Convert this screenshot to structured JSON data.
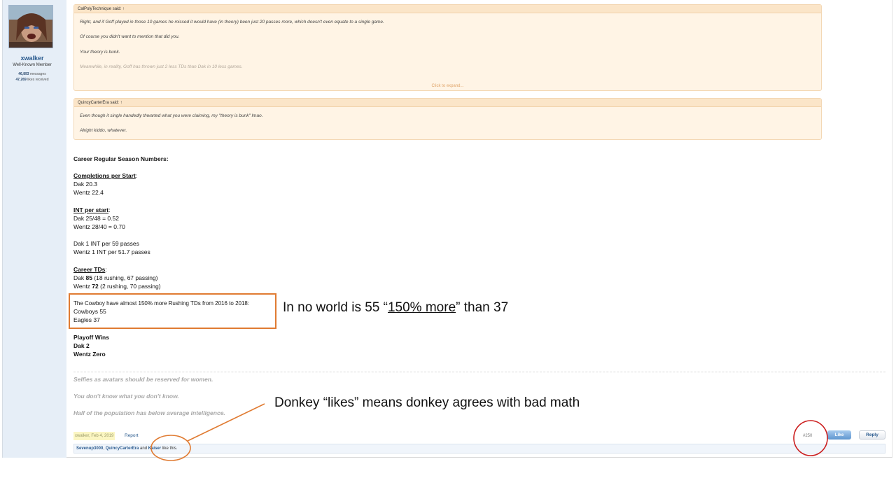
{
  "user": {
    "username": "xwalker",
    "title": "Well-Known Member",
    "messages_count": "46,893",
    "messages_label": "messages",
    "likes_count": "47,269",
    "likes_label": "likes received"
  },
  "quotes": [
    {
      "header": "CalPolyTechnique said: ↑",
      "lines": [
        "Right, and if Goff played in those 10 games he missed it would have (in theory) been just 20 passes more, which doesn't even equate to a single game.",
        "Of course you didn't want to mention that did you.",
        "Your theory is bunk.",
        "Meanwhile, in reality, Goff has thrown just 2 less TDs than Dak in 10 less games."
      ],
      "expand": "Click to expand..."
    },
    {
      "header": "QuincyCarterEra said: ↑",
      "lines": [
        "Even though it single handedly thwarted what you were claiming, my \"theory is bunk\" lmao.",
        "Alright kiddo, whatever."
      ]
    }
  ],
  "post": {
    "heading": "Career Regular Season Numbers:",
    "completions_title": "Completions per Start",
    "completions": [
      "Dak 20.3",
      "Wentz 22.4"
    ],
    "int_title": "INT per start",
    "int_lines": [
      "Dak 25/48 = 0.52",
      "Wentz 28/40 = 0.70"
    ],
    "int_pass_lines": [
      "Dak 1 INT per 59 passes",
      "Wentz 1 INT per 51.7 passes"
    ],
    "tds_title": "Career TDs",
    "tds": [
      {
        "name": "Dak ",
        "total": "85",
        "detail": " (18 rushing, 67 passing)"
      },
      {
        "name": "Wentz ",
        "total": "72",
        "detail": " (2 rushing, 70 passing)"
      }
    ],
    "rushing_claim": "The Cowboy have almost 150% more Rushing TDs from 2016 to 2018:",
    "rushing_lines": [
      "Cowboys 55",
      "Eagles 37"
    ],
    "playoff_lines": [
      "Playoff Wins",
      "Dak 2",
      "Wentz Zero"
    ]
  },
  "signature": [
    "Selfies as avatars should be reserved for women.",
    "You don't know what you don't know.",
    "Half of the population has below average intelligence."
  ],
  "footer": {
    "meta": "xwalker, Feb 4, 2019",
    "report": "Report",
    "post_number": "#250",
    "like_label": "Like",
    "reply_label": "Reply",
    "likers": [
      "Sevenup3000",
      "QuincyCarterEra",
      "Kaiser"
    ],
    "likers_sep": ", ",
    "likers_and": " and ",
    "likers_suffix": " like this."
  },
  "annotations": {
    "math_prefix": "In no world is 55 “",
    "math_emph": "150% more",
    "math_suffix": "” than 37",
    "donkey": "Donkey “likes” means donkey agrees with bad math"
  },
  "colors": {
    "annotation_orange": "#e07b32",
    "annotation_red": "#cc1f1f",
    "link_blue": "#2b5b8f"
  }
}
